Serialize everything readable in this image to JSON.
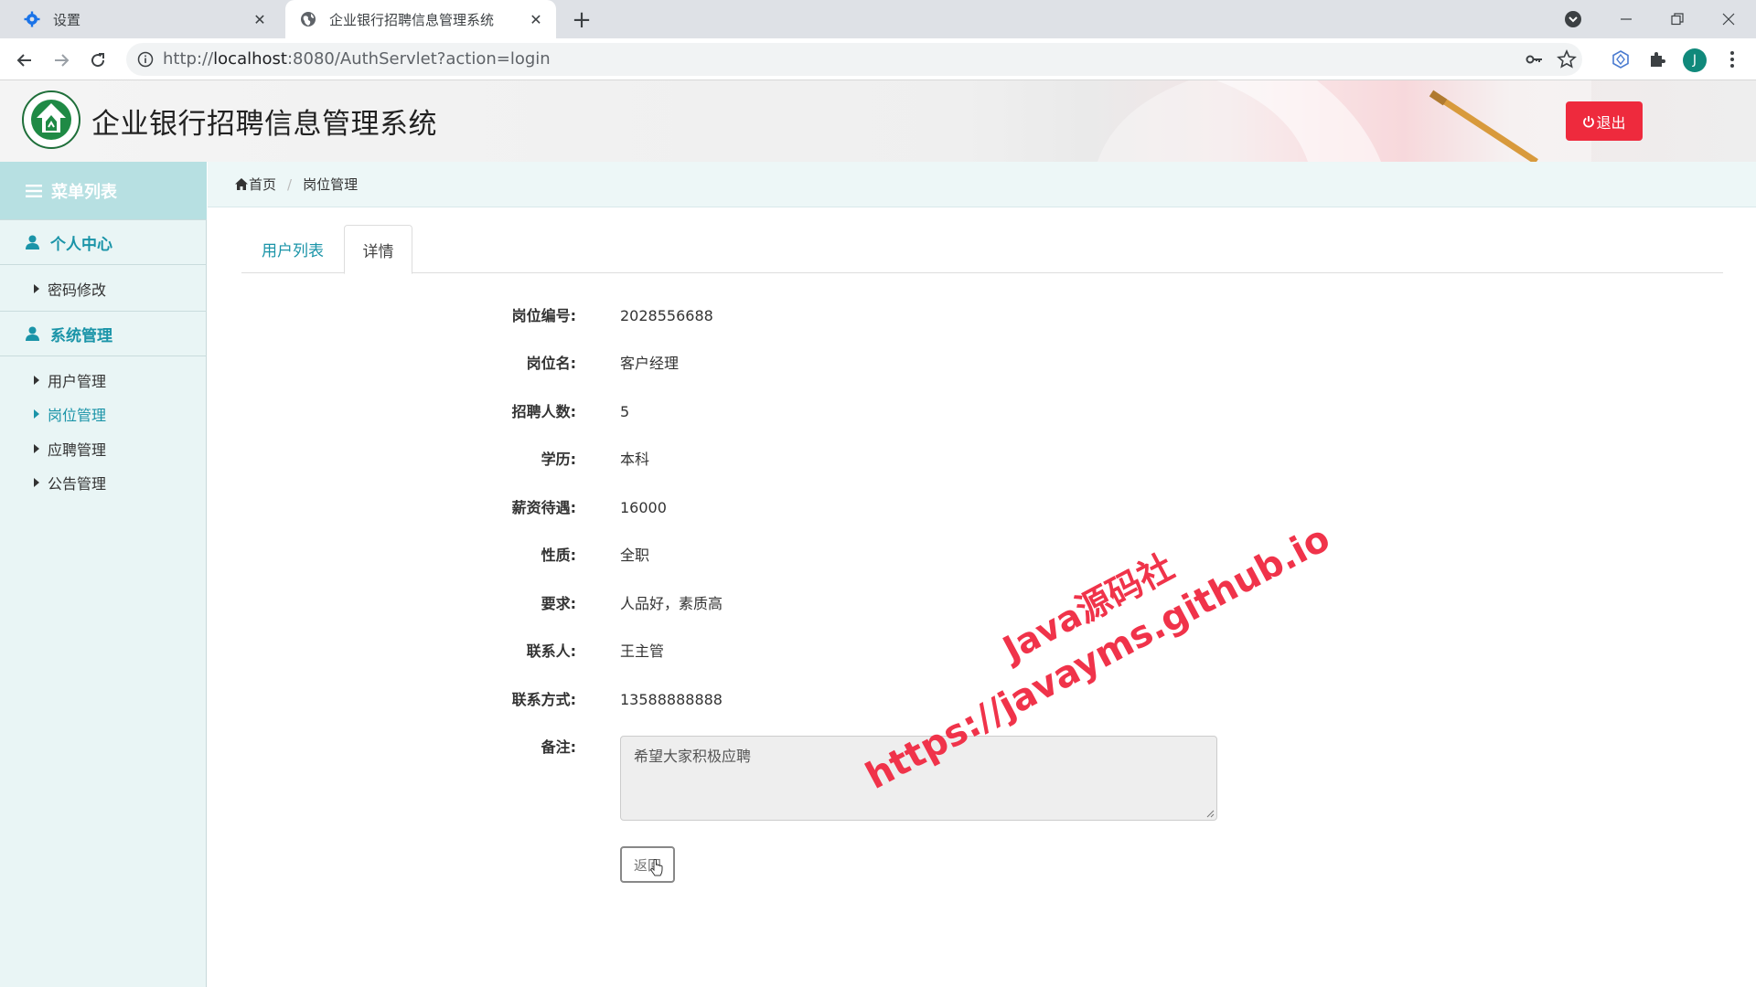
{
  "browser": {
    "tabs": [
      {
        "title": "设置",
        "icon": "gear-icon"
      },
      {
        "title": "企业银行招聘信息管理系统",
        "icon": "globe-icon"
      }
    ],
    "url_prefix": "http://",
    "url_host": "localhost",
    "url_rest": ":8080/AuthServlet?action=login",
    "profile_initial": "J"
  },
  "header": {
    "title": "企业银行招聘信息管理系统",
    "logout_label": "退出"
  },
  "sidebar": {
    "menu_head": "菜单列表",
    "groups": [
      {
        "title": "个人中心",
        "items": [
          {
            "label": "密码修改"
          }
        ]
      },
      {
        "title": "系统管理",
        "items": [
          {
            "label": "用户管理"
          },
          {
            "label": "岗位管理"
          },
          {
            "label": "应聘管理"
          },
          {
            "label": "公告管理"
          }
        ]
      }
    ],
    "active_item": "岗位管理"
  },
  "breadcrumb": {
    "home": "首页",
    "current": "岗位管理"
  },
  "content_tabs": [
    {
      "label": "用户列表"
    },
    {
      "label": "详情"
    }
  ],
  "detail": {
    "fields": [
      {
        "label": "岗位编号:",
        "value": "2028556688"
      },
      {
        "label": "岗位名:",
        "value": "客户经理"
      },
      {
        "label": "招聘人数:",
        "value": "5"
      },
      {
        "label": "学历:",
        "value": "本科"
      },
      {
        "label": "薪资待遇:",
        "value": "16000"
      },
      {
        "label": "性质:",
        "value": "全职"
      },
      {
        "label": "要求:",
        "value": "人品好，素质高"
      },
      {
        "label": "联系人:",
        "value": "王主管"
      },
      {
        "label": "联系方式:",
        "value": "13588888888"
      }
    ],
    "remark_label": "备注:",
    "remark_value": "希望大家积极应聘",
    "back_label": "返回"
  },
  "watermark": {
    "line1": "Java源码社",
    "line2": "https://javayms.github.io"
  },
  "colors": {
    "accent": "#1a94a8",
    "logout": "#ee2a3d",
    "sidebar_bg": "#e9f5f5",
    "menu_head_bg": "#b7e0e2"
  }
}
